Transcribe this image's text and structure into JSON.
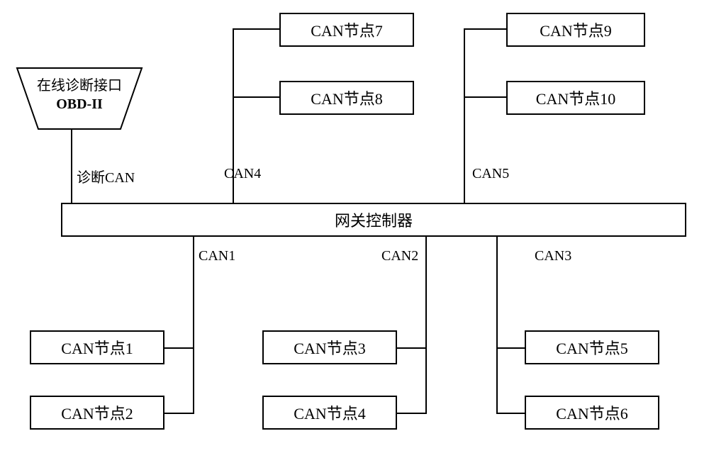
{
  "obd": {
    "line1": "在线诊断接口",
    "line2": "OBD-II"
  },
  "gateway": "网关控制器",
  "bus_labels": {
    "diag": "诊断CAN",
    "can1": "CAN1",
    "can2": "CAN2",
    "can3": "CAN3",
    "can4": "CAN4",
    "can5": "CAN5"
  },
  "nodes": {
    "n1": "CAN节点1",
    "n2": "CAN节点2",
    "n3": "CAN节点3",
    "n4": "CAN节点4",
    "n5": "CAN节点5",
    "n6": "CAN节点6",
    "n7": "CAN节点7",
    "n8": "CAN节点8",
    "n9": "CAN节点9",
    "n10": "CAN节点10"
  }
}
